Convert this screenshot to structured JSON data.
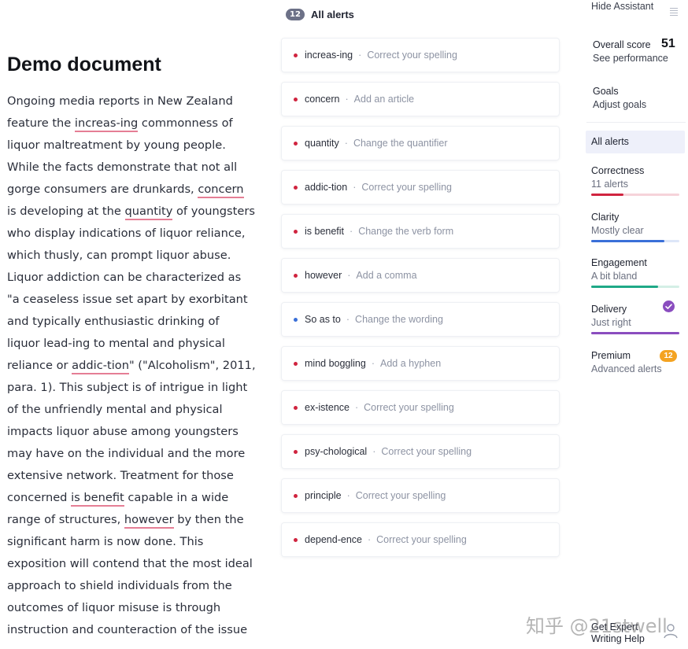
{
  "document": {
    "title": "Demo document",
    "lines": [
      [
        {
          "t": "Ongoing media reports in New Zealand"
        }
      ],
      [
        {
          "t": "feature the "
        },
        {
          "t": "increas-ing",
          "mark": true
        },
        {
          "t": " commonness of"
        }
      ],
      [
        {
          "t": "liquor maltreatment by young people."
        }
      ],
      [
        {
          "t": "While the facts demonstrate that not all"
        }
      ],
      [
        {
          "t": "gorge consumers are drunkards, "
        },
        {
          "t": "concern",
          "mark": true
        }
      ],
      [
        {
          "t": "is developing at the "
        },
        {
          "t": "quantity",
          "mark": true
        },
        {
          "t": " of youngsters"
        }
      ],
      [
        {
          "t": "who display indications of liquor reliance,"
        }
      ],
      [
        {
          "t": "which thusly, can prompt liquor abuse."
        }
      ],
      [
        {
          "t": "Liquor addiction can be characterized as"
        }
      ],
      [
        {
          "t": "\"a ceaseless issue set apart by exorbitant"
        }
      ],
      [
        {
          "t": "and typically enthusiastic drinking of"
        }
      ],
      [
        {
          "t": "liquor lead-ing to mental and physical"
        }
      ],
      [
        {
          "t": "reliance or "
        },
        {
          "t": "addic-tion",
          "mark": true
        },
        {
          "t": "\" (\"Alcoholism\", 2011,"
        }
      ],
      [
        {
          "t": "para. 1). This subject is of intrigue in light"
        }
      ],
      [
        {
          "t": "of the unfriendly mental and physical"
        }
      ],
      [
        {
          "t": "impacts liquor abuse among youngsters"
        }
      ],
      [
        {
          "t": "may have on the individual and the more"
        }
      ],
      [
        {
          "t": "extensive network. Treatment for those"
        }
      ],
      [
        {
          "t": "concerned "
        },
        {
          "t": "is benefit",
          "mark": true
        },
        {
          "t": " capable in a wide"
        }
      ],
      [
        {
          "t": "range of structures, "
        },
        {
          "t": "however",
          "mark": true
        },
        {
          "t": " by then the"
        }
      ],
      [
        {
          "t": "significant harm is now done. This"
        }
      ],
      [
        {
          "t": "exposition will contend that the most ideal"
        }
      ],
      [
        {
          "t": "approach to shield individuals from the"
        }
      ],
      [
        {
          "t": "outcomes of liquor misuse is through"
        }
      ],
      [
        {
          "t": "instruction and counteraction of the issue"
        }
      ]
    ]
  },
  "alerts": {
    "count": "12",
    "header_label": "All alerts",
    "items": [
      {
        "word": "increas-ing",
        "action": "Correct your spelling",
        "color": "#d0243f"
      },
      {
        "word": "concern",
        "action": "Add an article",
        "color": "#d0243f"
      },
      {
        "word": "quantity",
        "action": "Change the quantifier",
        "color": "#d0243f"
      },
      {
        "word": "addic-tion",
        "action": "Correct your spelling",
        "color": "#d0243f"
      },
      {
        "word": "is benefit",
        "action": "Change the verb form",
        "color": "#d0243f"
      },
      {
        "word": "however",
        "action": "Add a comma",
        "color": "#d0243f"
      },
      {
        "word": "So as to",
        "action": "Change the wording",
        "color": "#3a6fd8"
      },
      {
        "word": "mind boggling",
        "action": "Add a hyphen",
        "color": "#d0243f"
      },
      {
        "word": "ex-istence",
        "action": "Correct your spelling",
        "color": "#d0243f"
      },
      {
        "word": "psy-chological",
        "action": "Correct your spelling",
        "color": "#d0243f"
      },
      {
        "word": "principle",
        "action": "Correct your spelling",
        "color": "#d0243f"
      },
      {
        "word": "depend-ence",
        "action": "Correct your spelling",
        "color": "#d0243f"
      }
    ],
    "separator": "·"
  },
  "sidebar": {
    "hide_assistant": "Hide Assistant",
    "overall_score_label": "Overall score",
    "overall_score_value": "51",
    "see_performance": "See performance",
    "goals_label": "Goals",
    "adjust_goals": "Adjust goals",
    "all_alerts": "All alerts",
    "categories": [
      {
        "name": "Correctness",
        "sub": "11 alerts",
        "level": 0.37,
        "color": "#d0243f",
        "track": "#f6d3da"
      },
      {
        "name": "Clarity",
        "sub": "Mostly clear",
        "level": 0.83,
        "color": "#3a6fd8",
        "track": "#dde6f8"
      },
      {
        "name": "Engagement",
        "sub": "A bit bland",
        "level": 0.76,
        "color": "#1fa987",
        "track": "#d4efe6"
      },
      {
        "name": "Delivery",
        "sub": "Just right",
        "level": 1.0,
        "color": "#8a4dbf",
        "track": "#e8dcf3"
      }
    ],
    "premium_label": "Premium",
    "premium_count": "12",
    "premium_sub": "Advanced alerts",
    "expert_help": "Get Expert Writing Help"
  },
  "watermark": "知乎 @21stwell",
  "colors": {
    "underline": "#e57e95",
    "premium_badge": "#f4a321",
    "count_pill": "#6c7187",
    "all_alerts_bg": "#eef0fa"
  }
}
